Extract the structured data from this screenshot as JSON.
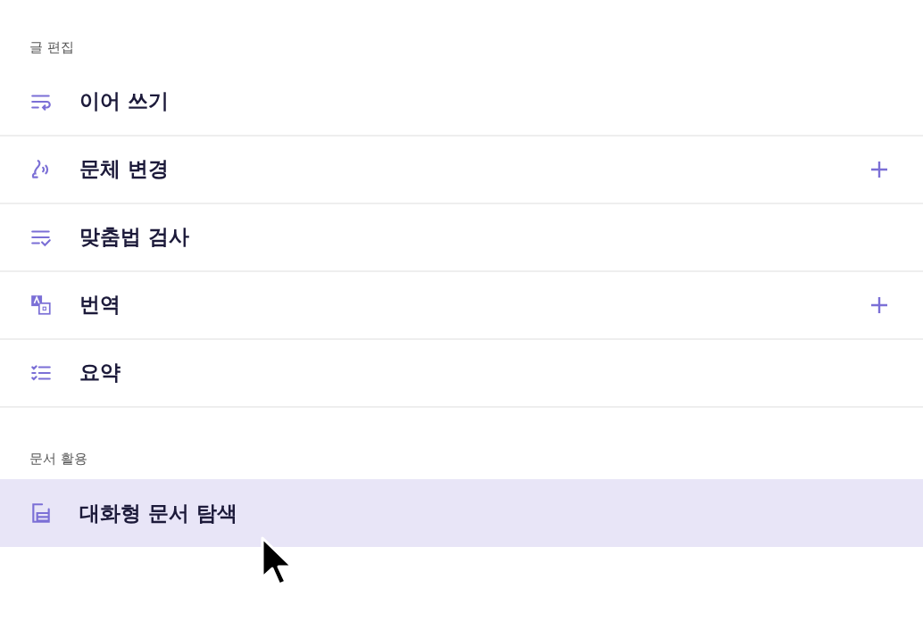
{
  "sections": [
    {
      "title": "글 편집",
      "items": [
        {
          "label": "이어 쓰기",
          "kind": "continue",
          "expandable": false,
          "selected": false
        },
        {
          "label": "문체 변경",
          "kind": "style",
          "expandable": true,
          "selected": false
        },
        {
          "label": "맞춤법 검사",
          "kind": "spell",
          "expandable": false,
          "selected": false
        },
        {
          "label": "번역",
          "kind": "translate",
          "expandable": true,
          "selected": false
        },
        {
          "label": "요약",
          "kind": "summary",
          "expandable": false,
          "selected": false
        }
      ]
    },
    {
      "title": "문서 활용",
      "items": [
        {
          "label": "대화형 문서 탐색",
          "kind": "document",
          "expandable": false,
          "selected": true
        }
      ]
    }
  ]
}
